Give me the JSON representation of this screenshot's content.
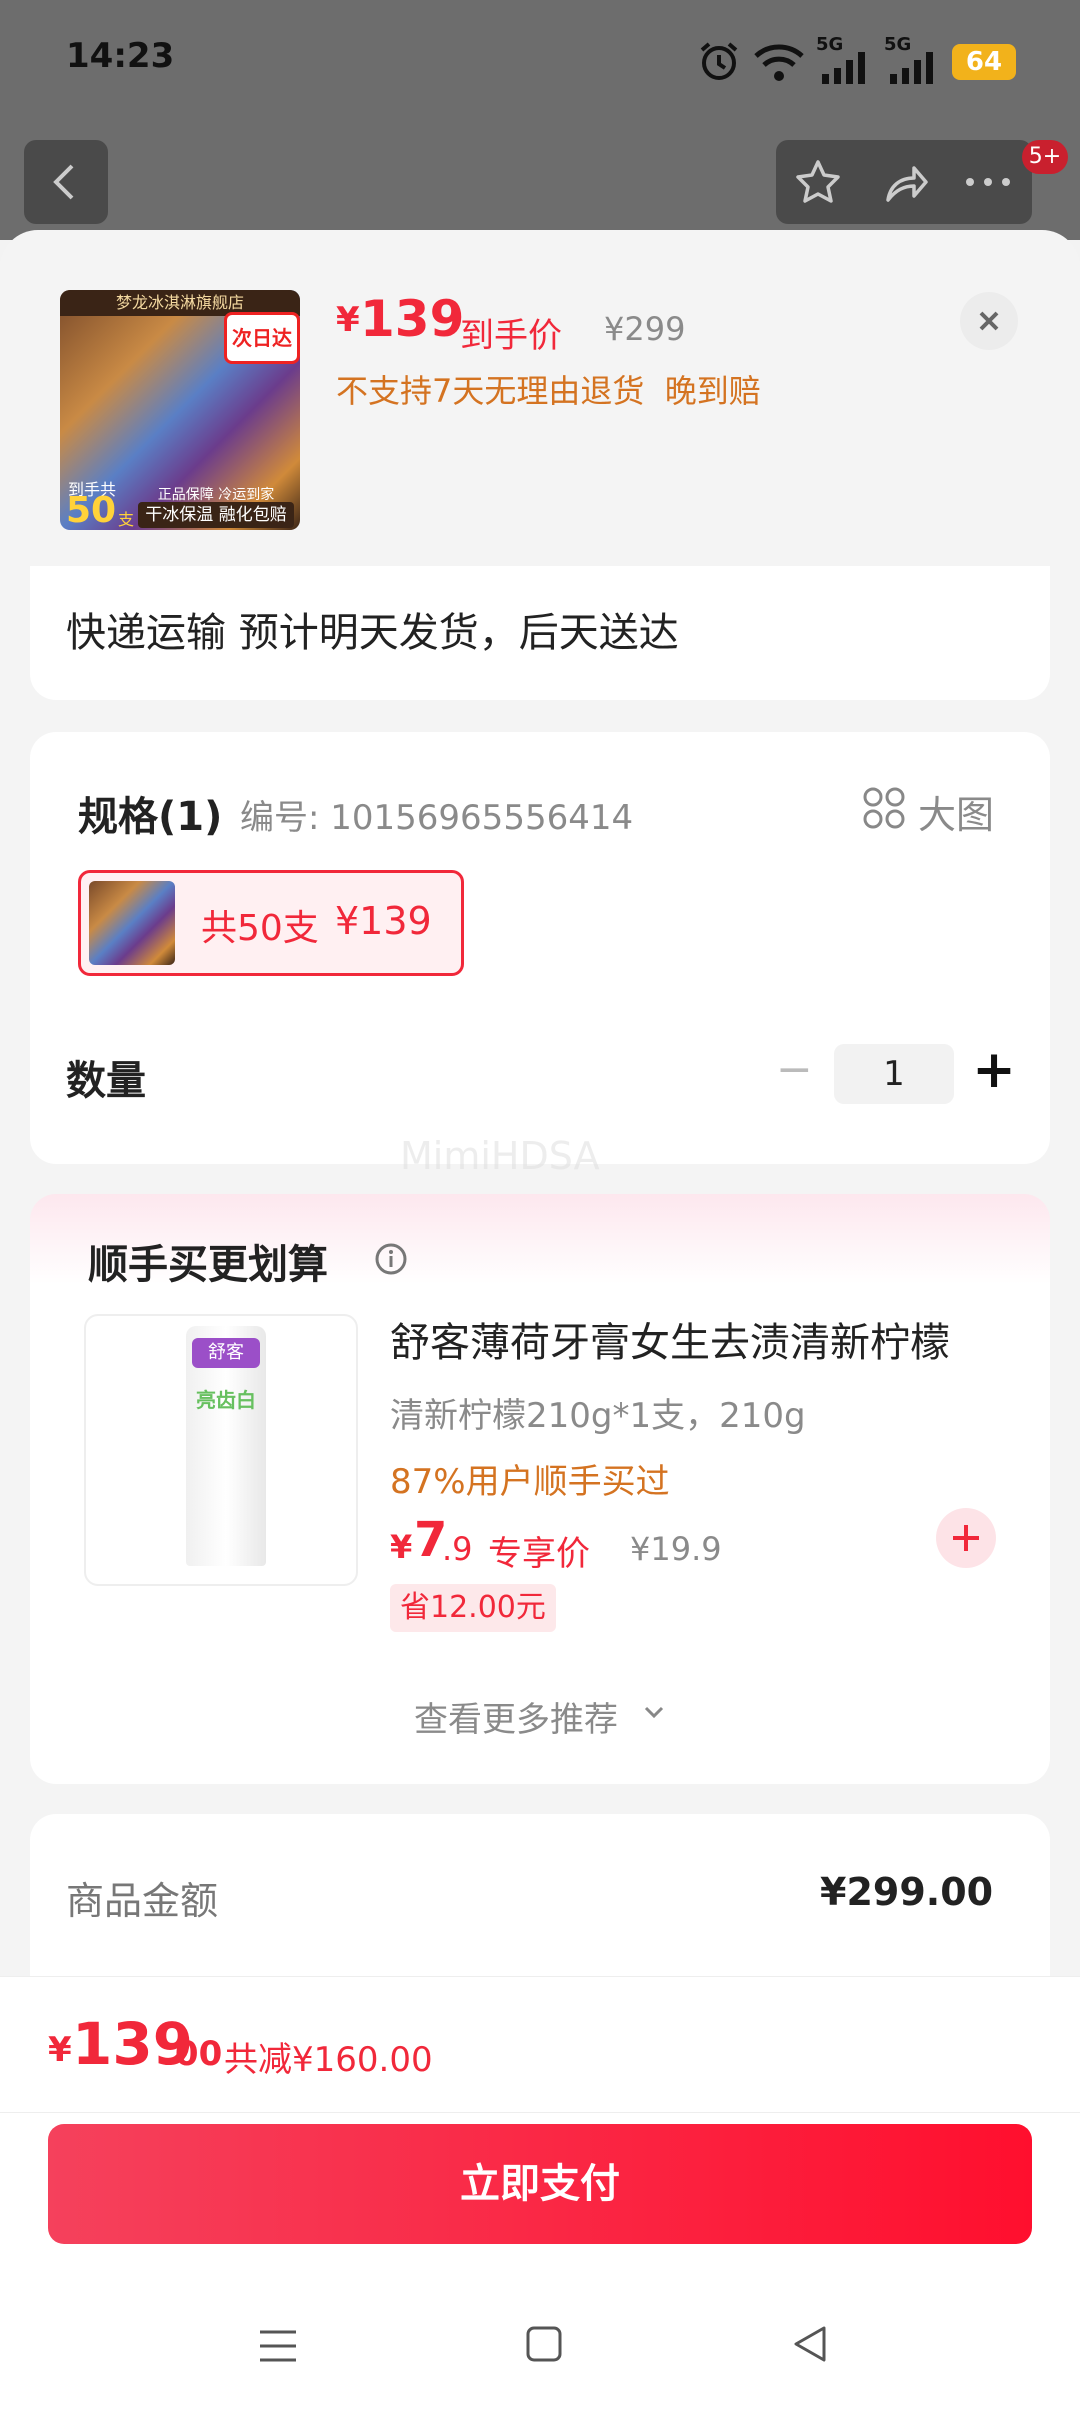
{
  "status_bar": {
    "time": "14:23",
    "network_1": "5G",
    "network_2": "5G",
    "battery": "64"
  },
  "background_nav": {
    "badge": "5+"
  },
  "product_header": {
    "currency": "¥",
    "price": "139",
    "price_label": "到手价",
    "original_price": "¥299",
    "tags": "不支持7天无理由退货  晚到赔",
    "thumb_badge": "次日达",
    "thumb_count": "50",
    "thumb_count_unit": "支",
    "thumb_count_prefix": "到手共",
    "thumb_footer": "干冰保温 融化包赔",
    "thumb_sub": "正品保障 冷运到家",
    "thumb_store": "梦龙冰淇淋旗舰店"
  },
  "delivery": {
    "text": "快递运输 预计明天发货，后天送达"
  },
  "spec": {
    "title": "规格(1)",
    "code": "编号: 10156965556414",
    "large_view": "大图",
    "option_label": "共50支",
    "option_price": "¥139"
  },
  "quantity": {
    "label": "数量",
    "value": "1",
    "minus": "−",
    "plus": "+"
  },
  "watermark": "MimiHDSA",
  "addon": {
    "title": "顺手买更划算",
    "item": {
      "name": "舒客薄荷牙膏女生去渍清新柠檬",
      "variant": "清新柠檬210g*1支，210g",
      "social": "87%用户顺手买过",
      "currency": "¥",
      "price_int": "7",
      "price_dec": ".9",
      "price_label": "专享价",
      "original_price": "¥19.9",
      "savings": "省12.00元",
      "brand_text": "舒客",
      "product_text": "亮齿白"
    },
    "more": "查看更多推荐"
  },
  "summary": {
    "label": "商品金额",
    "value": "¥299.00"
  },
  "footer": {
    "currency": "¥",
    "total_int": "139",
    "total_dec": ".00",
    "discount": "共减¥160.00",
    "pay_button": "立即支付"
  },
  "colors": {
    "accent": "#f1283a",
    "orange": "#d47321",
    "sheet_bg": "#f4f4f4"
  }
}
